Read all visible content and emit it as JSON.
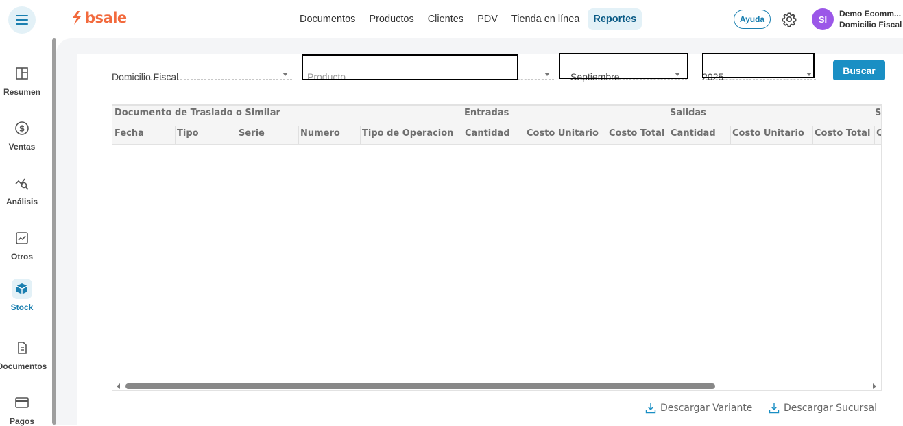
{
  "app": {
    "logo_text": "bsale",
    "brand_color": "#f26a3d",
    "accent_color": "#1a8fc4"
  },
  "header": {
    "menu_icon": "hamburger-icon",
    "nav": [
      {
        "label": "Documentos",
        "active": false
      },
      {
        "label": "Productos",
        "active": false
      },
      {
        "label": "Clientes",
        "active": false
      },
      {
        "label": "PDV",
        "active": false
      },
      {
        "label": "Tienda en línea",
        "active": false
      },
      {
        "label": "Reportes",
        "active": true
      }
    ],
    "help_label": "Ayuda",
    "settings_icon": "gear-icon",
    "user": {
      "initials": "SI",
      "name": "Demo Ecomm...",
      "branch": "Domicilio Fiscal"
    }
  },
  "sidebar": {
    "items": [
      {
        "label": "Resumen",
        "icon": "dashboard-icon",
        "active": false
      },
      {
        "label": "Ventas",
        "icon": "dollar-icon",
        "active": false
      },
      {
        "label": "Análisis",
        "icon": "analytics-icon",
        "active": false
      },
      {
        "label": "Otros",
        "icon": "trend-icon",
        "active": false
      },
      {
        "label": "Stock",
        "icon": "box-icon",
        "active": true
      },
      {
        "label": "Documentos",
        "icon": "document-icon",
        "active": false
      },
      {
        "label": "Pagos",
        "icon": "card-icon",
        "active": false
      }
    ]
  },
  "filters": {
    "branch": "Domicilio Fiscal",
    "product_placeholder": "Producto",
    "month": "Septiembre",
    "year": "2025",
    "search_label": "Buscar"
  },
  "table": {
    "groups": [
      "Documento de Traslado o Similar",
      "Entradas",
      "Salidas",
      "S"
    ],
    "columns": [
      "Fecha",
      "Tipo",
      "Serie",
      "Numero",
      "Tipo de Operacion",
      "Cantidad",
      "Costo Unitario",
      "Costo Total",
      "Cantidad",
      "Costo Unitario",
      "Costo Total",
      "C"
    ],
    "rows": []
  },
  "downloads": {
    "variant_label": "Descargar Variante",
    "branch_label": "Descargar Sucursal"
  }
}
